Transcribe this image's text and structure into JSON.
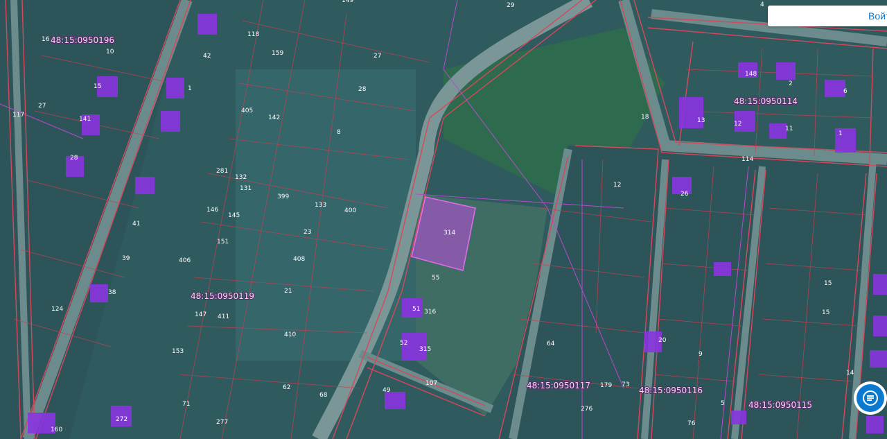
{
  "header": {
    "login_label": "Войти"
  },
  "colors": {
    "boundary": "#d9475a",
    "quarter_line": "#b84ad0",
    "building_fill": "#8a34e0",
    "parcel_highlight": "#c04ce0",
    "accent": "#0a7ad0"
  },
  "icons": {
    "chat": "chat-icon"
  },
  "quarters": [
    "48:15:0950196",
    "48:15:0950114",
    "48:15:0950119",
    "48:15:0950117",
    "48:15:0950116",
    "48:15:0950115"
  ],
  "parcel_labels": [
    "149",
    "29",
    "4",
    "118",
    "159",
    "10",
    "16",
    "42",
    "27",
    "148",
    "2",
    "1",
    "15",
    "405",
    "142",
    "28",
    "6",
    "117",
    "27",
    "8",
    "141",
    "13",
    "12",
    "11",
    "1",
    "18",
    "114",
    "28",
    "281",
    "132",
    "131",
    "399",
    "133",
    "400",
    "12",
    "26",
    "41",
    "146",
    "145",
    "314",
    "151",
    "23",
    "39",
    "406",
    "408",
    "55",
    "38",
    "21",
    "147",
    "411",
    "316",
    "51",
    "15",
    "124",
    "410",
    "52",
    "315",
    "20",
    "9",
    "153",
    "107",
    "179",
    "73",
    "62",
    "68",
    "49",
    "14",
    "71",
    "272",
    "277",
    "160",
    "276",
    "5",
    "76",
    "64",
    "15",
    "14"
  ],
  "highlight_parcel": "314"
}
